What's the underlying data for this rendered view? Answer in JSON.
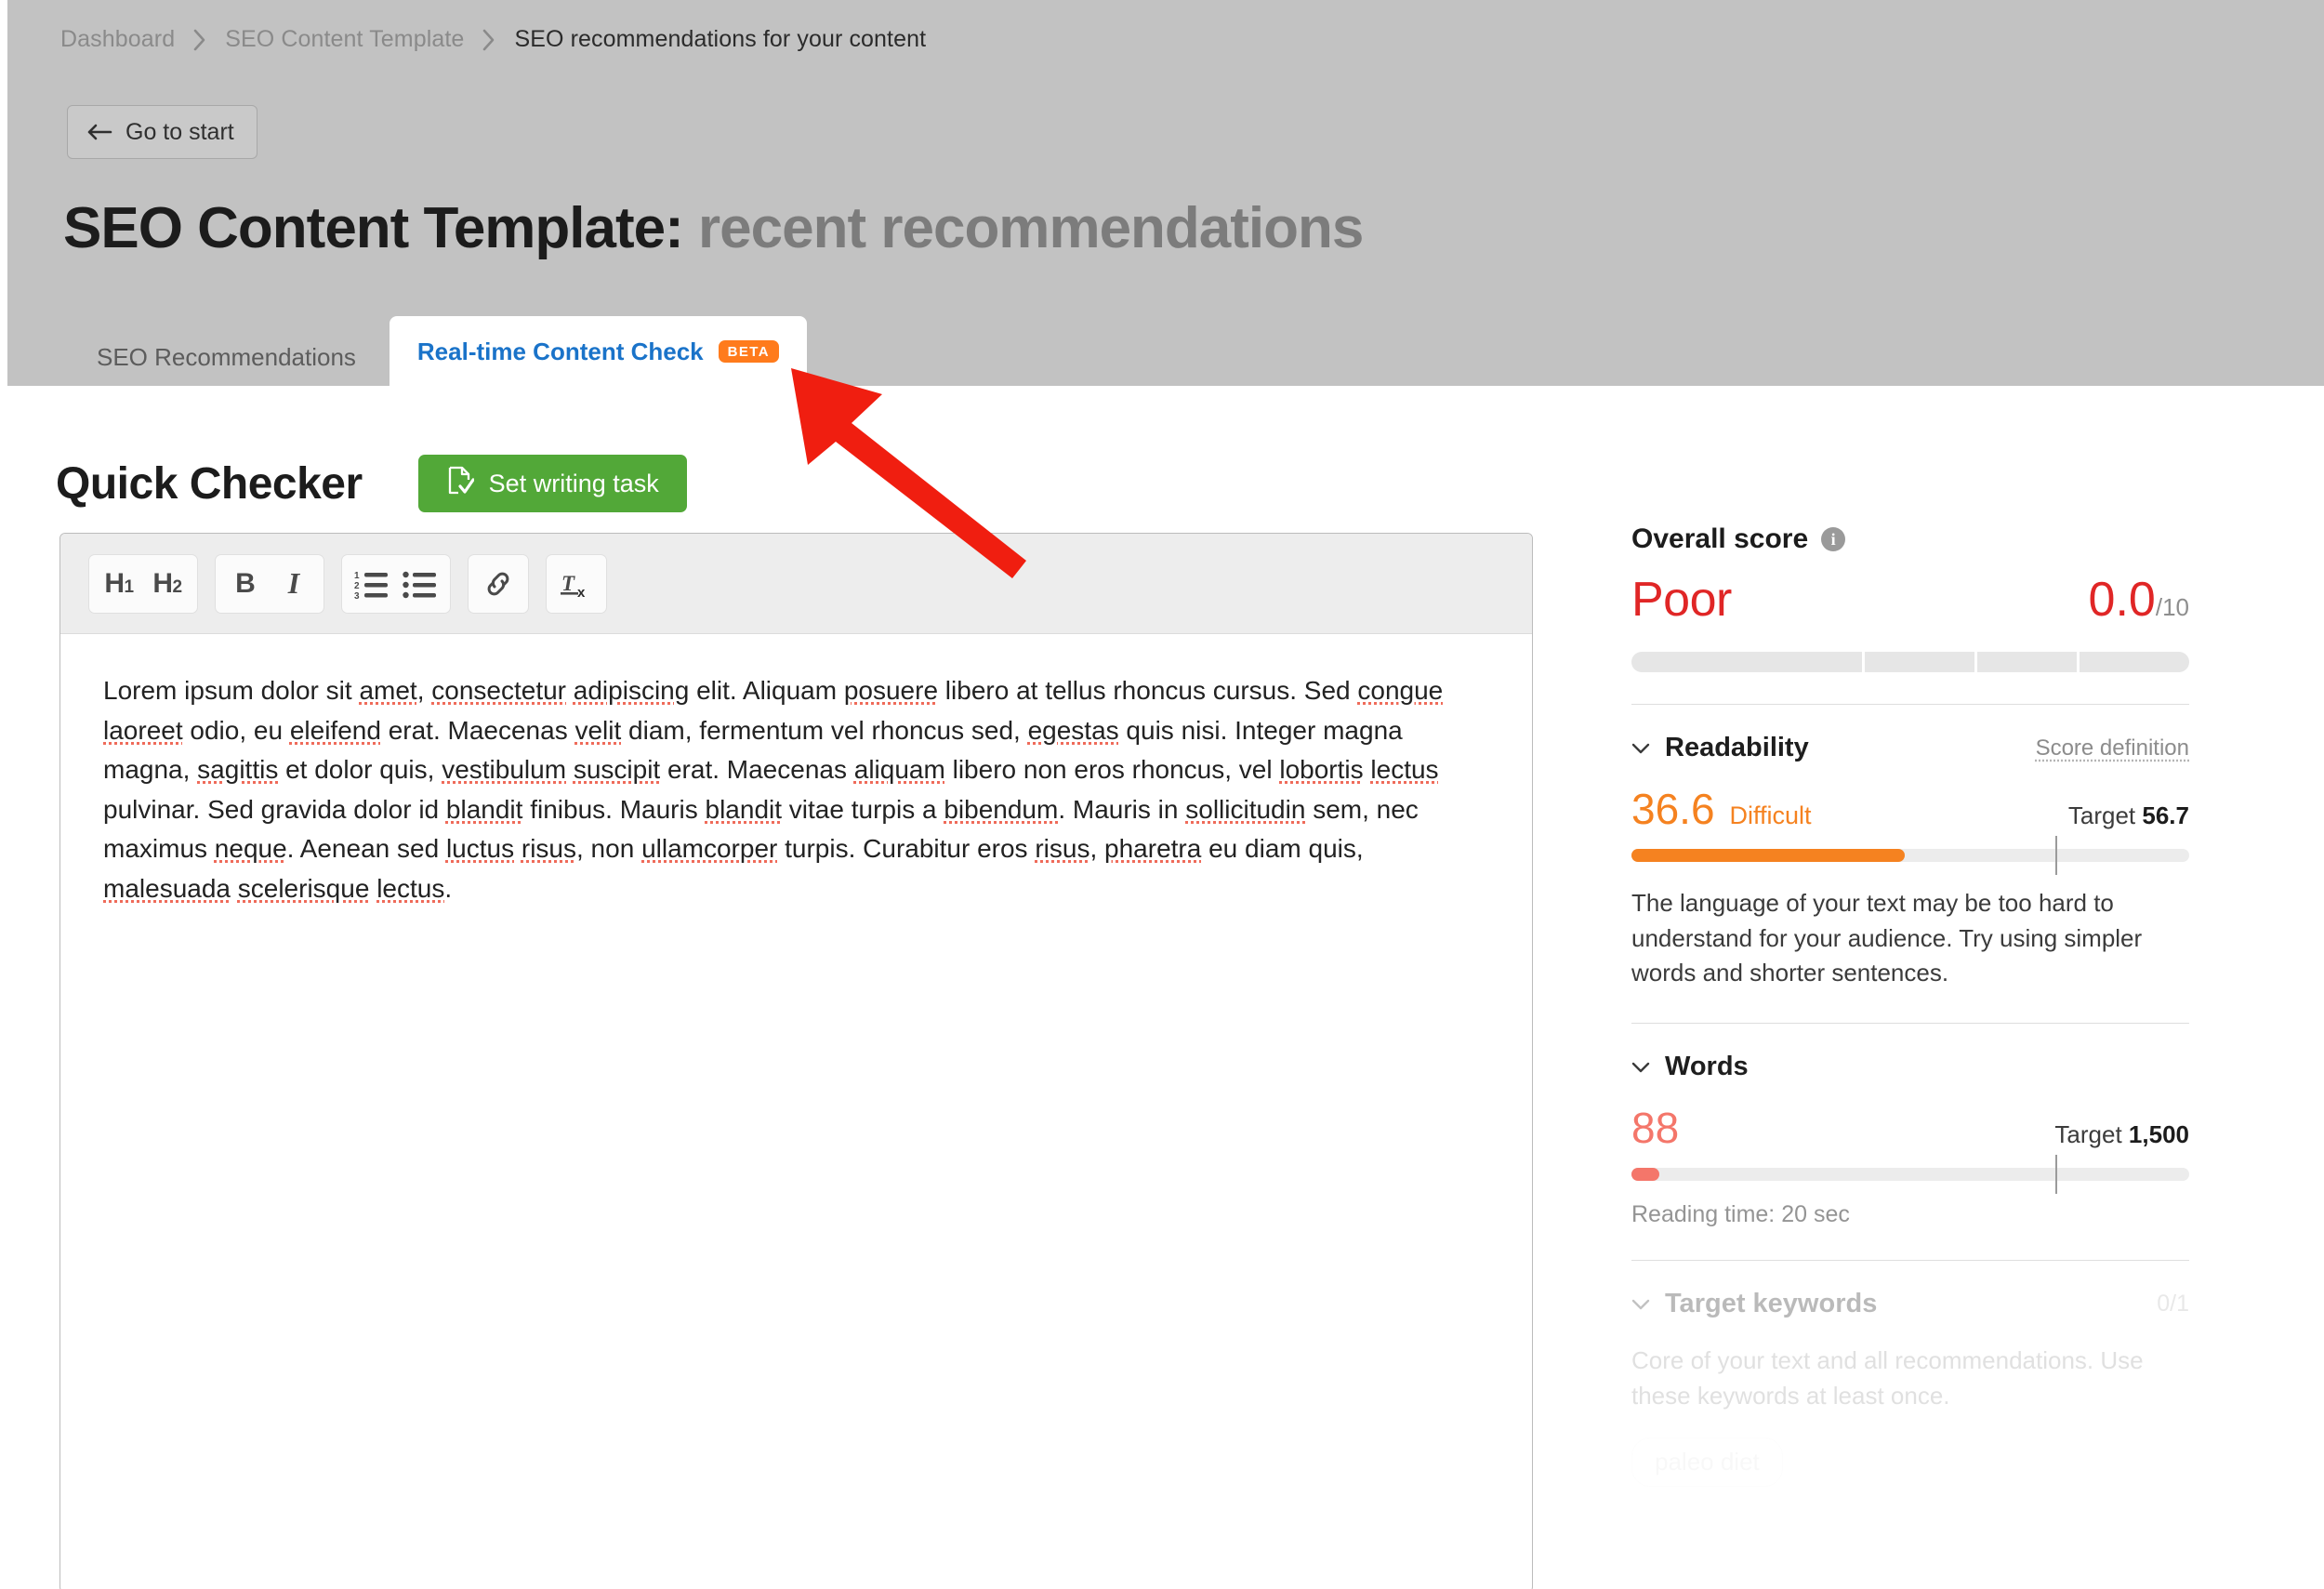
{
  "breadcrumb": {
    "items": [
      {
        "label": "Dashboard",
        "current": false
      },
      {
        "label": "SEO Content Template",
        "current": false
      },
      {
        "label": "SEO recommendations for your content",
        "current": true
      }
    ]
  },
  "header": {
    "back_button": "Go to start",
    "back_icon": "arrow-left-icon",
    "title_main": "SEO Content Template:",
    "title_muted": "recent recommendations"
  },
  "tabs": [
    {
      "label": "SEO Recommendations",
      "active": false,
      "badge": null
    },
    {
      "label": "Real-time Content Check",
      "active": true,
      "badge": "BETA"
    }
  ],
  "main": {
    "section_title": "Quick Checker",
    "set_task_button": "Set writing task",
    "set_task_icon": "document-check-icon"
  },
  "toolbar": {
    "groups": [
      {
        "buttons": [
          {
            "name": "heading-1-button",
            "label": "H",
            "sub": "1"
          },
          {
            "name": "heading-2-button",
            "label": "H",
            "sub": "2"
          }
        ]
      },
      {
        "buttons": [
          {
            "name": "bold-button",
            "label": "B",
            "sub": ""
          },
          {
            "name": "italic-button",
            "label": "I",
            "sub": ""
          }
        ]
      },
      {
        "buttons": [
          {
            "name": "ordered-list-button",
            "label": "",
            "sub": ""
          },
          {
            "name": "bullet-list-button",
            "label": "",
            "sub": ""
          }
        ]
      },
      {
        "buttons": [
          {
            "name": "link-button",
            "label": "",
            "sub": ""
          }
        ]
      },
      {
        "buttons": [
          {
            "name": "clear-formatting-button",
            "label": "",
            "sub": ""
          }
        ]
      }
    ]
  },
  "editor": {
    "body_text": "Lorem ipsum dolor sit amet, consectetur adipiscing elit. Aliquam posuere libero at tellus rhoncus cursus. Sed congue laoreet odio, eu eleifend erat. Maecenas velit diam, fermentum vel rhoncus sed, egestas quis nisi. Integer magna magna, sagittis et dolor quis, vestibulum suscipit erat. Maecenas aliquam libero non eros rhoncus, vel lobortis lectus pulvinar. Sed gravida dolor id blandit finibus. Mauris blandit vitae turpis a bibendum. Mauris in sollicitudin sem, nec maximus neque. Aenean sed luctus risus, non ullamcorper turpis. Curabitur eros risus, pharetra eu diam quis, malesuada scelerisque lectus.",
    "misspelled_words": [
      "amet",
      "consectetur",
      "adipiscing",
      "posuere",
      "congue",
      "laoreet",
      "eleifend",
      "velit",
      "egestas",
      "sagittis",
      "vestibulum",
      "suscipit",
      "aliquam",
      "lobortis",
      "lectus",
      "blandit",
      "bibendum",
      "sollicitudin",
      "neque",
      "luctus",
      "risus",
      "ullamcorper",
      "pharetra",
      "malesuada",
      "scelerisque"
    ]
  },
  "sidebar": {
    "overall": {
      "title": "Overall score",
      "info_icon": "info-icon",
      "rating": "Poor",
      "value": "0.0",
      "denominator": "/10",
      "color": "#e02626",
      "segments": [
        42,
        20,
        18,
        20
      ]
    },
    "readability": {
      "title": "Readability",
      "score_definition_link": "Score definition",
      "value": "36.6",
      "label": "Difficult",
      "target_prefix": "Target",
      "target_value": "56.7",
      "color": "#f58220",
      "fill_percent": 49,
      "target_percent": 76,
      "description": "The language of your text may be too hard to understand for your audience. Try using simpler words and shorter sentences."
    },
    "words": {
      "title": "Words",
      "value": "88",
      "target_prefix": "Target",
      "target_value": "1,500",
      "color": "#f4766a",
      "fill_percent": 5,
      "target_percent": 76,
      "reading_time": "Reading time: 20 sec"
    },
    "target_keywords": {
      "title": "Target keywords",
      "count": "0/1",
      "description": "Core of your text and all recommendations. Use these keywords at least once.",
      "chips": [
        "paleo diet"
      ]
    }
  },
  "annotation": {
    "arrow_color": "#f01e10",
    "name": "red-pointer-arrow"
  }
}
